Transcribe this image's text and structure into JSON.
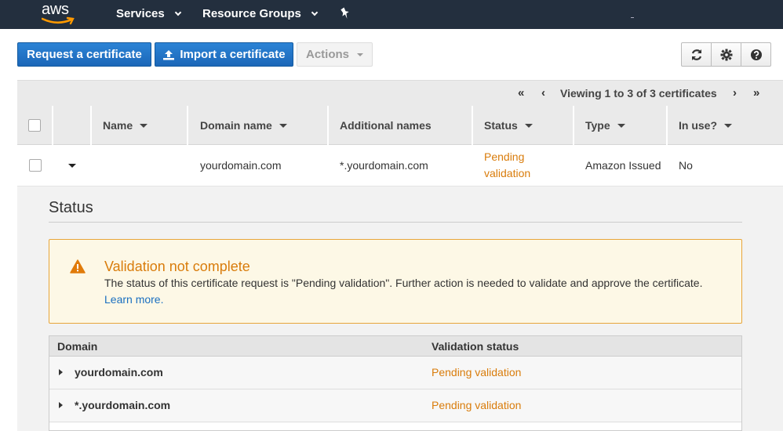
{
  "nav": {
    "logo": "aws",
    "services": "Services",
    "resource_groups": "Resource Groups",
    "pin_icon": "pin-icon"
  },
  "toolbar": {
    "request_label": "Request a certificate",
    "import_label": "Import a certificate",
    "actions_label": "Actions",
    "icons": [
      "refresh-icon",
      "gear-icon",
      "help-icon"
    ]
  },
  "pager": {
    "text": "Viewing 1 to 3 of 3 certificates"
  },
  "table": {
    "columns": {
      "name": "Name",
      "domain": "Domain name",
      "additional": "Additional names",
      "status": "Status",
      "type": "Type",
      "in_use": "In use?"
    },
    "rows": [
      {
        "name": "",
        "domain": "yourdomain.com",
        "additional": "*.yourdomain.com",
        "status_line1": "Pending",
        "status_line2": "validation",
        "type": "Amazon Issued",
        "in_use": "No"
      }
    ]
  },
  "detail": {
    "title": "Status",
    "alert": {
      "title": "Validation not complete",
      "message": "The status of this certificate request is \"Pending validation\". Further action is needed to validate and approve the certificate.",
      "link": "Learn more."
    },
    "validation": {
      "col_domain": "Domain",
      "col_status": "Validation status",
      "rows": [
        {
          "domain": "yourdomain.com",
          "status": "Pending validation"
        },
        {
          "domain": "*.yourdomain.com",
          "status": "Pending validation"
        }
      ]
    }
  },
  "colors": {
    "nav_bg": "#232f3e",
    "primary": "#1b67b8",
    "warning": "#d97c0b",
    "link": "#1a6fc0"
  }
}
